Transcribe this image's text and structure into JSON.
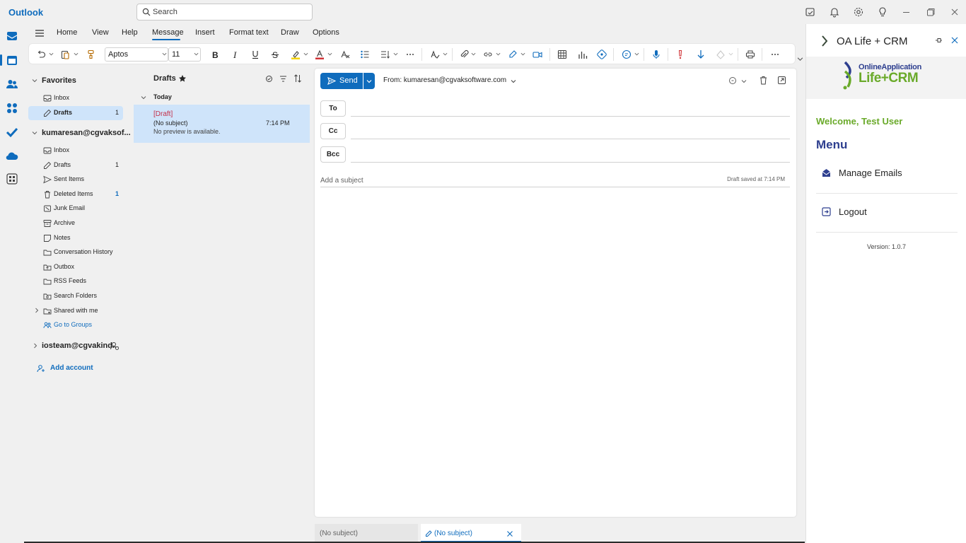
{
  "app": {
    "title": "Outlook"
  },
  "search": {
    "placeholder": "Search"
  },
  "ribbon": {
    "tabs": [
      "Home",
      "View",
      "Help",
      "Message",
      "Insert",
      "Format text",
      "Draw",
      "Options"
    ],
    "active_tab": "Message",
    "font_name": "Aptos",
    "font_size": "11"
  },
  "folders": {
    "favorites_label": "Favorites",
    "favorites": [
      {
        "label": "Inbox",
        "icon": "inbox-icon",
        "count": ""
      },
      {
        "label": "Drafts",
        "icon": "pencil-icon",
        "count": "1"
      }
    ],
    "account1_label": "kumaresan@cgvaksof...",
    "account1": [
      {
        "label": "Inbox",
        "icon": "inbox-icon",
        "count": ""
      },
      {
        "label": "Drafts",
        "icon": "pencil-icon",
        "count": "1"
      },
      {
        "label": "Sent Items",
        "icon": "send-icon",
        "count": ""
      },
      {
        "label": "Deleted Items",
        "icon": "trash-icon",
        "count": "1"
      },
      {
        "label": "Junk Email",
        "icon": "junk-icon",
        "count": ""
      },
      {
        "label": "Archive",
        "icon": "archive-icon",
        "count": ""
      },
      {
        "label": "Notes",
        "icon": "note-icon",
        "count": ""
      },
      {
        "label": "Conversation History",
        "icon": "folder-icon",
        "count": ""
      },
      {
        "label": "Outbox",
        "icon": "outbox-icon",
        "count": ""
      },
      {
        "label": "RSS Feeds",
        "icon": "folder-icon",
        "count": ""
      },
      {
        "label": "Search Folders",
        "icon": "search-folder-icon",
        "count": ""
      },
      {
        "label": "Shared with me",
        "icon": "shared-folder-icon",
        "count": ""
      },
      {
        "label": "Go to Groups",
        "icon": "groups-icon",
        "count": ""
      }
    ],
    "account2_label": "iosteam@cgvakind...",
    "add_account": "Add account"
  },
  "message_list": {
    "title": "Drafts",
    "group": "Today",
    "items": [
      {
        "tag": "[Draft]",
        "subject": "(No subject)",
        "time": "7:14 PM",
        "preview": "No preview is available."
      }
    ]
  },
  "compose": {
    "send_label": "Send",
    "from": "From: kumaresan@cgvaksoftware.com",
    "to_label": "To",
    "cc_label": "Cc",
    "bcc_label": "Bcc",
    "subject_placeholder": "Add a subject",
    "draft_saved": "Draft saved at 7:14 PM"
  },
  "bottom_tabs": [
    "(No subject)",
    "(No subject)"
  ],
  "addin": {
    "title": "OA Life + CRM",
    "logo_top": "OnlineApplication",
    "logo_bottom": "Life+CRM",
    "welcome": "Welcome, Test User",
    "menu_title": "Menu",
    "menu": [
      {
        "label": "Manage Emails",
        "icon": "envelope-open-icon"
      },
      {
        "label": "Logout",
        "icon": "logout-icon"
      }
    ],
    "version": "Version: 1.0.7"
  },
  "colors": {
    "accent": "#0f6cbd",
    "selected": "#cfe4fa",
    "crm_green": "#6aaa2a",
    "crm_blue": "#2e3f8f",
    "draft_red": "#c4314b"
  }
}
